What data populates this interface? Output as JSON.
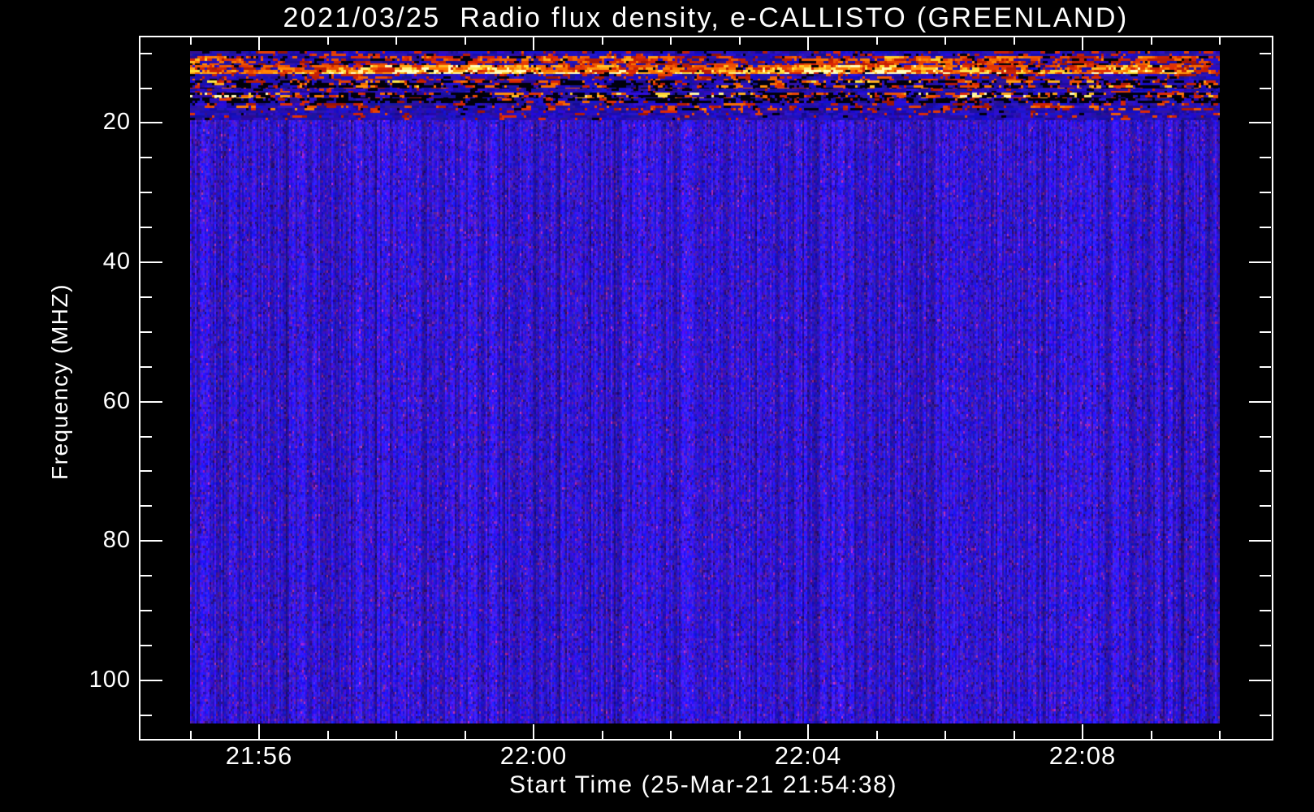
{
  "chart_data": {
    "type": "heatmap",
    "subtype": "radio-spectrogram",
    "title": "2021/03/25  Radio flux density, e-CALLISTO (GREENLAND)",
    "xlabel": "Start Time (25-Mar-21 21:54:38)",
    "ylabel": "Frequency (MHZ)",
    "x_tick_labels": [
      "21:56",
      "22:00",
      "22:04",
      "22:08"
    ],
    "x_minor_tick_interval_min": 1,
    "x_data_span": [
      "21:55:00",
      "22:10:00"
    ],
    "y_tick_values_mhz": [
      20,
      40,
      60,
      80,
      100
    ],
    "y_tick_labels": [
      "20",
      "40",
      "60",
      "80",
      "100"
    ],
    "y_minor_tick_step_mhz": 5,
    "y_axis_range_mhz": [
      7.6,
      108.4
    ],
    "y_axis_inverted": "low frequency at top",
    "image_freq_range_mhz": [
      9.7,
      106.0
    ],
    "grid": false,
    "legend": "none",
    "background_signal": "quiet blue continuum with vertical noise striping",
    "colormap": {
      "quiet": "#2213e0",
      "weak_streak": "#5a1eb4",
      "strong": "#ff3300",
      "intense": "#ffcc00",
      "saturated": "#ffffbe",
      "dropout": "#000000"
    },
    "rfi_bands": [
      {
        "freq_mhz": [
          9.7,
          10.4
        ],
        "desc": "sparse red interference specks",
        "hot": 0.2,
        "black": 0.05,
        "boost": 0.3
      },
      {
        "freq_mhz": [
          10.4,
          11.7
        ],
        "desc": "dense red interference dashes",
        "hot": 0.6,
        "black": 0.12,
        "boost": 0.5
      },
      {
        "freq_mhz": [
          11.7,
          12.9
        ],
        "desc": "very bright orange-yellow RFI band",
        "hot": 0.9,
        "black": 0.06,
        "boost": 0.95
      },
      {
        "freq_mhz": [
          13.0,
          13.9
        ],
        "desc": "moderate red dashes",
        "hot": 0.34,
        "black": 0.08,
        "boost": 0.4
      },
      {
        "freq_mhz": [
          13.9,
          15.0
        ],
        "desc": "dark dropout band with red bursts",
        "hot": 0.24,
        "black": 0.48,
        "boost": 0.55
      },
      {
        "freq_mhz": [
          15.0,
          15.6
        ],
        "desc": "weak mixed band",
        "hot": 0.1,
        "black": 0.06,
        "boost": 0.25
      },
      {
        "freq_mhz": [
          15.6,
          16.5
        ],
        "desc": "dark band with bright red-yellow bursts",
        "hot": 0.34,
        "black": 0.4,
        "boost": 0.9
      },
      {
        "freq_mhz": [
          16.5,
          17.2
        ],
        "desc": "dark dropout band",
        "hot": 0.12,
        "black": 0.55,
        "boost": 0.3
      },
      {
        "freq_mhz": [
          17.2,
          18.2
        ],
        "desc": "moderate red dashes",
        "hot": 0.3,
        "black": 0.08,
        "boost": 0.45
      },
      {
        "freq_mhz": [
          18.2,
          19.3
        ],
        "desc": "sparse fading specks",
        "hot": 0.1,
        "black": 0.03,
        "boost": 0.22
      }
    ],
    "quiet_above_mhz": 19.3
  },
  "frame_color": "#ffffff",
  "page_background": "#000000"
}
